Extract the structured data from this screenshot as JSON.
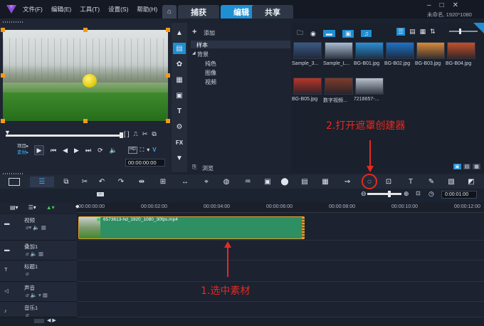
{
  "menu": [
    "文件(F)",
    "编辑(E)",
    "工具(T)",
    "设置(S)",
    "帮助(H)"
  ],
  "tabs": {
    "capture": "捕获",
    "edit": "编辑",
    "share": "共享"
  },
  "project_info": "未命名, 1920*1080",
  "preview": {
    "mode_labels": [
      "项目▸",
      "素材▸"
    ],
    "timecode": "00:00:00:00"
  },
  "library": {
    "add_label": "添加",
    "browse_label": "浏览",
    "tree": [
      "样本",
      "背景",
      "纯色",
      "图像",
      "视频"
    ],
    "thumbs": [
      {
        "label": "Sample_3...",
        "color": "#3b5a86"
      },
      {
        "label": "Sample_L...",
        "color": "#a9bcd0"
      },
      {
        "label": "BG-B01.jpg",
        "color": "#2a8fd6"
      },
      {
        "label": "BG-B02.jpg",
        "color": "#1e72c8"
      },
      {
        "label": "BG-B03.jpg",
        "color": "#d88a3a"
      },
      {
        "label": "BG-B04.jpg",
        "color": "#c4502a"
      },
      {
        "label": "BG-B05.jpg",
        "color": "#b8352a"
      },
      {
        "label": "数字视频...",
        "color": "#7f3b2a"
      },
      {
        "label": "7218657-...",
        "color": "#b8c2cc"
      }
    ]
  },
  "timeline": {
    "timecode": "0:00:01:00",
    "ruler": [
      "00:00:00:00",
      "00:00:02:00",
      "00:00:04:00",
      "00:00:06:00",
      "00:00:08:00",
      "00:00:10:00",
      "00:00:12:00"
    ],
    "tracks": [
      "视频",
      "叠加1",
      "标题1",
      "声音",
      "音乐1"
    ],
    "clip_name": "6573613-hd_1920_1080_30fps.mp4"
  },
  "annotations": {
    "step1": "1.选中素材",
    "step2": "2.打开遮罩创建器"
  }
}
